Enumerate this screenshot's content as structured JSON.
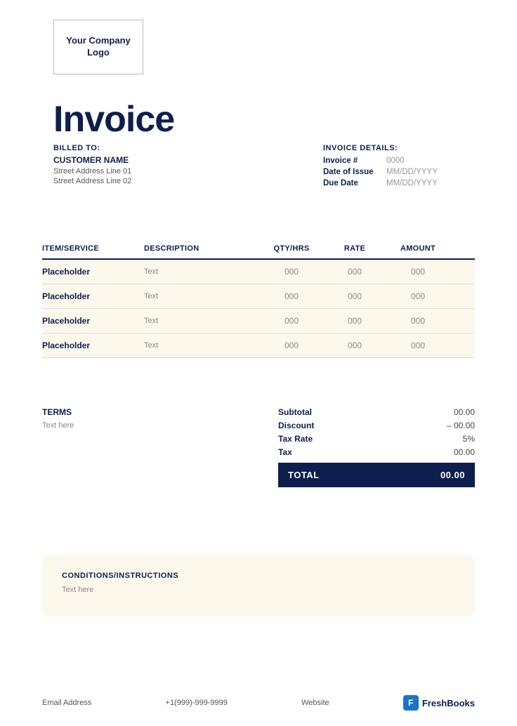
{
  "logo": {
    "text": "Your Company Logo"
  },
  "invoice": {
    "title": "Invoice"
  },
  "billed_to": {
    "label": "BILLED TO:",
    "customer_name": "CUSTOMER NAME",
    "address_line1": "Street Address Line 01",
    "address_line2": "Street Address Line 02"
  },
  "invoice_details": {
    "label": "INVOICE DETAILS:",
    "rows": [
      {
        "key": "Invoice #",
        "value": "0000"
      },
      {
        "key": "Date of Issue",
        "value": "MM/DD/YYYY"
      },
      {
        "key": "Due Date",
        "value": "MM/DD/YYYY"
      }
    ]
  },
  "table": {
    "headers": [
      "ITEM/SERVICE",
      "DESCRIPTION",
      "QTY/HRS",
      "RATE",
      "AMOUNT"
    ],
    "rows": [
      {
        "item": "Placeholder",
        "desc": "Text",
        "qty": "000",
        "rate": "000",
        "amount": "000"
      },
      {
        "item": "Placeholder",
        "desc": "Text",
        "qty": "000",
        "rate": "000",
        "amount": "000"
      },
      {
        "item": "Placeholder",
        "desc": "Text",
        "qty": "000",
        "rate": "000",
        "amount": "000"
      },
      {
        "item": "Placeholder",
        "desc": "Text",
        "qty": "000",
        "rate": "000",
        "amount": "000"
      }
    ]
  },
  "terms": {
    "title": "TERMS",
    "text": "Text here"
  },
  "totals": {
    "subtotal_label": "Subtotal",
    "subtotal_value": "00.00",
    "discount_label": "Discount",
    "discount_value": "– 00.00",
    "tax_rate_label": "Tax Rate",
    "tax_rate_value": "5%",
    "tax_label": "Tax",
    "tax_value": "00.00",
    "total_label": "TOTAL",
    "total_value": "00.00"
  },
  "conditions": {
    "title": "CONDITIONS/INSTRUCTIONS",
    "text": "Text here"
  },
  "footer": {
    "email": "Email Address",
    "phone": "+1(999)-999-9999",
    "website": "Website",
    "freshbooks": "FreshBooks",
    "fb_icon": "F"
  }
}
